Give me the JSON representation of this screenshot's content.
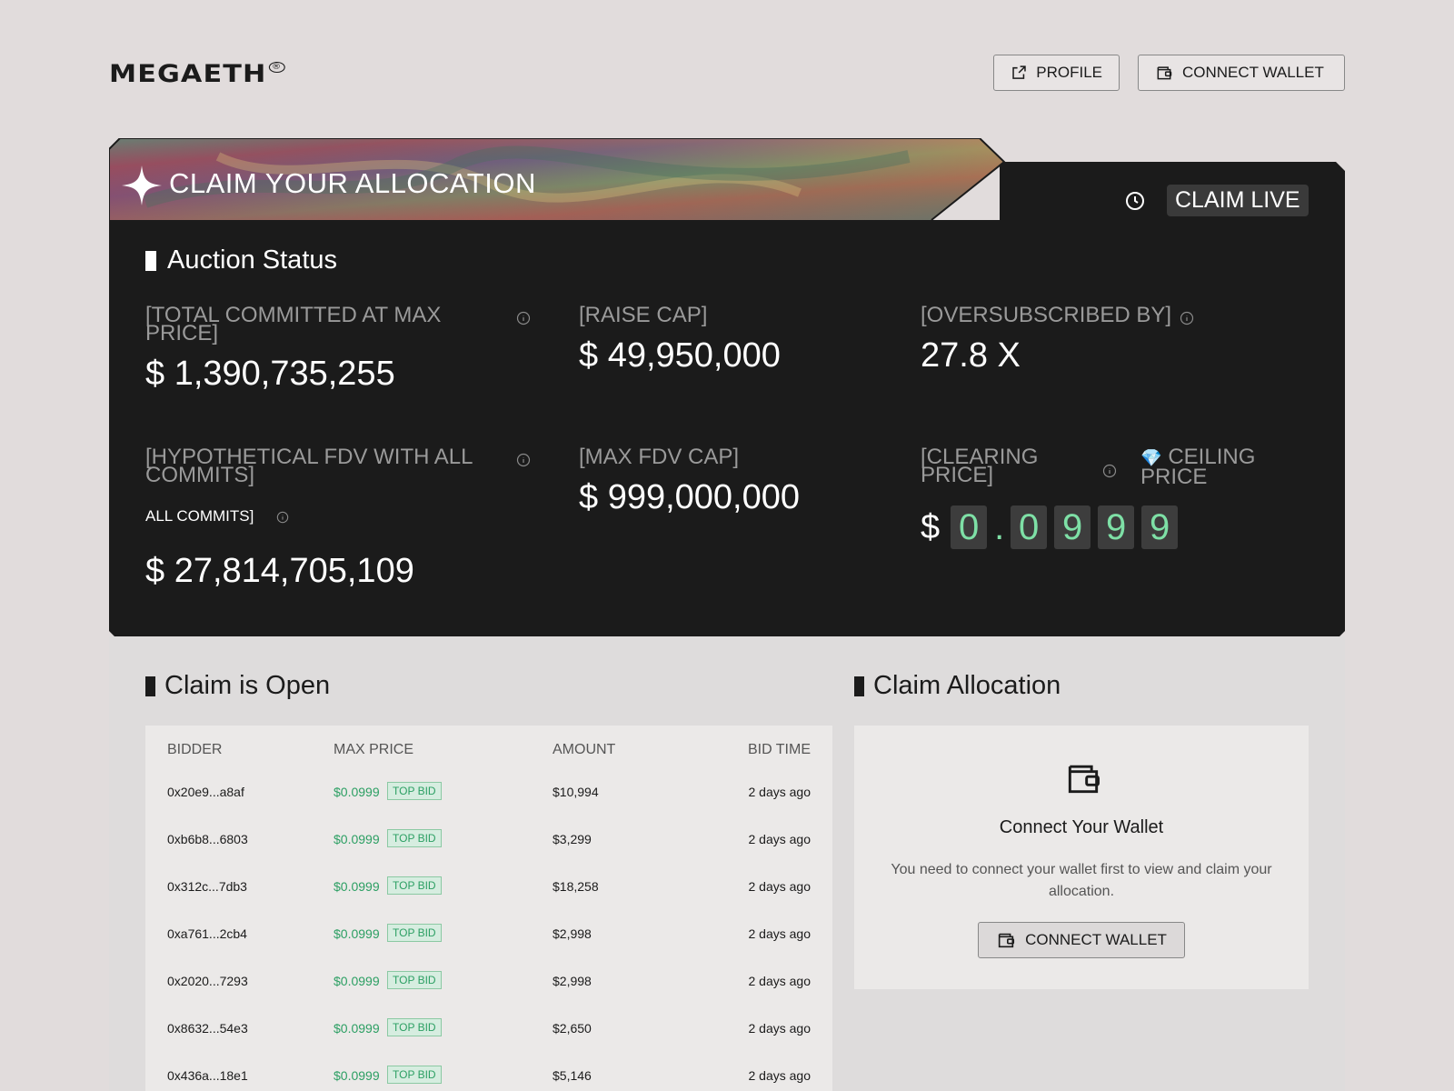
{
  "header": {
    "logo": "MEGAETH",
    "logo_mark": "®",
    "profile_label": "PROFILE",
    "connect_label": "CONNECT WALLET"
  },
  "banner": {
    "title": "CLAIM YOUR ALLOCATION",
    "status": "CLAIM LIVE"
  },
  "auction": {
    "title": "Auction Status",
    "total_committed_label": "[TOTAL COMMITTED AT MAX PRICE]",
    "total_committed_value": "$ 1,390,735,255",
    "raise_cap_label": "[RAISE CAP]",
    "raise_cap_value": "$ 49,950,000",
    "oversubscribed_label": "[OVERSUBSCRIBED BY]",
    "oversubscribed_value": "27.8 X",
    "hypo_fdv_label": "[HYPOTHETICAL FDV WITH ALL COMMITS]",
    "hypo_fdv_sublabel": "ALL COMMITS]",
    "hypo_fdv_value": "$ 27,814,705,109",
    "max_fdv_label": "[MAX FDV CAP]",
    "max_fdv_value": "$ 999,000,000",
    "clearing_price_label": "[CLEARING PRICE]",
    "ceiling_label": "CEILING PRICE",
    "ceiling_emoji": "💎",
    "price_currency": "$",
    "price_digits": [
      "0",
      ".",
      "0",
      "9",
      "9",
      "9"
    ]
  },
  "claim_open": {
    "title": "Claim is Open",
    "columns": [
      "BIDDER",
      "MAX PRICE",
      "AMOUNT",
      "BID TIME"
    ],
    "rows": [
      {
        "bidder": "0x20e9...a8af",
        "price": "$0.0999",
        "tag": "TOP BID",
        "amount": "$10,994",
        "time": "2 days ago"
      },
      {
        "bidder": "0xb6b8...6803",
        "price": "$0.0999",
        "tag": "TOP BID",
        "amount": "$3,299",
        "time": "2 days ago"
      },
      {
        "bidder": "0x312c...7db3",
        "price": "$0.0999",
        "tag": "TOP BID",
        "amount": "$18,258",
        "time": "2 days ago"
      },
      {
        "bidder": "0xa761...2cb4",
        "price": "$0.0999",
        "tag": "TOP BID",
        "amount": "$2,998",
        "time": "2 days ago"
      },
      {
        "bidder": "0x2020...7293",
        "price": "$0.0999",
        "tag": "TOP BID",
        "amount": "$2,998",
        "time": "2 days ago"
      },
      {
        "bidder": "0x8632...54e3",
        "price": "$0.0999",
        "tag": "TOP BID",
        "amount": "$2,650",
        "time": "2 days ago"
      },
      {
        "bidder": "0x436a...18e1",
        "price": "$0.0999",
        "tag": "TOP BID",
        "amount": "$5,146",
        "time": "2 days ago"
      }
    ]
  },
  "claim_alloc": {
    "title": "Claim Allocation",
    "heading": "Connect Your Wallet",
    "description": "You need to connect your wallet first to view and claim your allocation.",
    "button_label": "CONNECT WALLET"
  },
  "colors": {
    "background": "#e1dcdc",
    "card": "#1b1b1b",
    "accent_green": "#2c9f63",
    "digit_green": "#7ee0a6"
  },
  "icons": [
    "external-link-icon",
    "wallet-icon",
    "sparkle-icon",
    "clock-icon",
    "info-icon",
    "diamond-icon"
  ]
}
